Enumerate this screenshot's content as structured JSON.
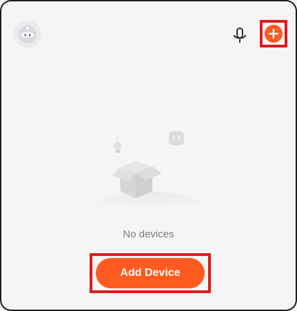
{
  "top_bar": {
    "avatar_icon": "robot-avatar-icon",
    "mic_icon": "microphone-icon",
    "add_icon": "plus-circle-icon"
  },
  "empty_state": {
    "message": "No devices",
    "illustration_icons": [
      "lightbulb-icon",
      "smart-plug-icon",
      "open-box-icon"
    ]
  },
  "primary_action": {
    "label": "Add Device"
  },
  "colors": {
    "accent": "#ff5a1f",
    "highlight_border": "#e01919",
    "background": "#f5f5f5",
    "muted_text": "#7a7a7a"
  }
}
